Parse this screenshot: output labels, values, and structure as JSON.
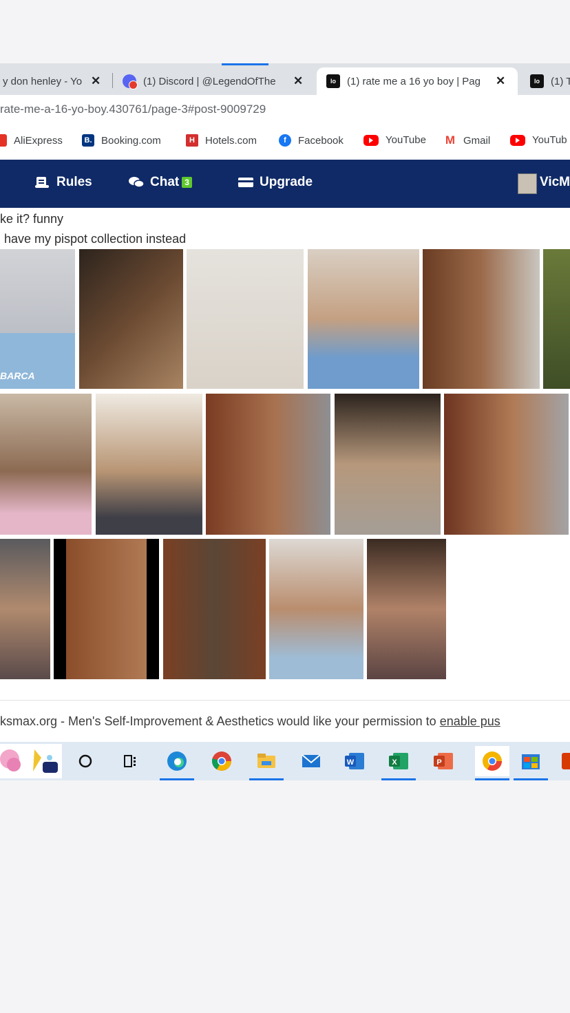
{
  "browser": {
    "tabs": [
      {
        "title": "y don henley - Yo",
        "close": "✕"
      },
      {
        "title": "(1) Discord | @LegendOfThe",
        "close": "✕"
      },
      {
        "title": "(1) rate me a 16 yo boy | Pag",
        "close": "✕"
      },
      {
        "title": "(1) T"
      }
    ],
    "url": "rate-me-a-16-yo-boy.430761/page-3#post-9009729",
    "bookmarks": [
      "AliExpress",
      "Booking.com",
      "Hotels.com",
      "Facebook",
      "YouTube",
      "Gmail",
      "YouTub"
    ],
    "bookmark_icons": {
      "booking": "B.",
      "hotels": "H",
      "facebook": "f",
      "gmail": "M"
    }
  },
  "site_nav": {
    "rules": "Rules",
    "chat": "Chat",
    "chat_badge": "3",
    "upgrade": "Upgrade",
    "user": "VicM"
  },
  "post": {
    "line1": "ke it? funny",
    "line2": "have my pispot collection instead",
    "photo_rows": [
      [
        "selfie-photo",
        "selfie-photo",
        "selfie-photo",
        "selfie-photo",
        "selfie-photo",
        "selfie-photo"
      ],
      [
        "selfie-photo",
        "selfie-photo",
        "selfie-photo",
        "selfie-photo",
        "selfie-photo"
      ],
      [
        "selfie-photo",
        "selfie-photo",
        "selfie-photo",
        "selfie-photo",
        "selfie-photo"
      ]
    ],
    "shirt_text": "BARCA"
  },
  "notification": {
    "text": "ksmax.org - Men's Self-Improvement & Aesthetics would like your permission to ",
    "link": "enable pus"
  },
  "taskbar": {
    "items": [
      "widget-icon",
      "cortana-icon",
      "task-view-icon",
      "edge-icon",
      "chrome-icon",
      "file-explorer-icon",
      "mail-icon",
      "word-icon",
      "excel-icon",
      "powerpoint-icon",
      "chrome-canary-icon",
      "store-icon",
      "office-icon"
    ],
    "labels": {
      "word": "W",
      "excel": "X",
      "powerpoint": "P"
    }
  }
}
